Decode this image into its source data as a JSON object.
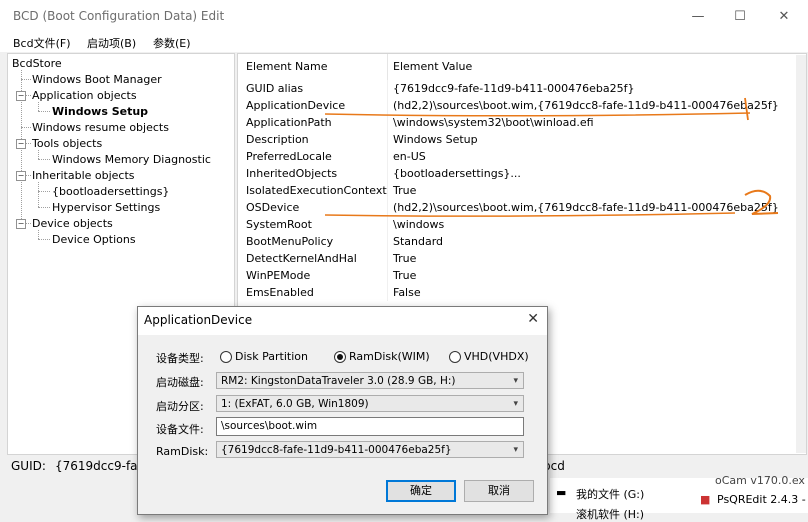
{
  "window": {
    "title": "BCD (Boot Configuration Data) Edit"
  },
  "menu": [
    "Bcd文件(F)",
    "启动项(B)",
    "参数(E)"
  ],
  "tree": {
    "root": "BcdStore",
    "nodes": [
      {
        "label": "Windows Boot Manager"
      },
      {
        "label": "Application objects",
        "children": [
          {
            "label": "Windows Setup",
            "selected": true
          }
        ]
      },
      {
        "label": "Windows resume objects"
      },
      {
        "label": "Tools objects",
        "children": [
          {
            "label": "Windows Memory Diagnostic"
          }
        ]
      },
      {
        "label": "Inheritable objects",
        "children": [
          {
            "label": "{bootloadersettings}"
          },
          {
            "label": "Hypervisor Settings"
          }
        ]
      },
      {
        "label": "Device objects",
        "children": [
          {
            "label": "Device Options"
          }
        ]
      }
    ]
  },
  "list": {
    "headers": [
      "Element Name",
      "Element Value"
    ],
    "rows": [
      [
        "GUID alias",
        "{7619dcc9-fafe-11d9-b411-000476eba25f}"
      ],
      [
        "ApplicationDevice",
        "(hd2,2)\\sources\\boot.wim,{7619dcc8-fafe-11d9-b411-000476eba25f}"
      ],
      [
        "ApplicationPath",
        "\\windows\\system32\\boot\\winload.efi"
      ],
      [
        "Description",
        "Windows Setup"
      ],
      [
        "PreferredLocale",
        "en-US"
      ],
      [
        "InheritedObjects",
        "{bootloadersettings}..."
      ],
      [
        "IsolatedExecutionContext",
        "True"
      ],
      [
        "OSDevice",
        "(hd2,2)\\sources\\boot.wim,{7619dcc8-fafe-11d9-b411-000476eba25f}"
      ],
      [
        "SystemRoot",
        "\\windows"
      ],
      [
        "BootMenuPolicy",
        "Standard"
      ],
      [
        "DetectKernelAndHal",
        "True"
      ],
      [
        "WinPEMode",
        "True"
      ],
      [
        "EmsEnabled",
        "False"
      ]
    ]
  },
  "status": {
    "guid_label": "GUID:",
    "guid_value": "{7619dcc9-fafe",
    "right_text": "bcd"
  },
  "desktop": {
    "items": [
      "oCam v170.0.ex",
      "我的文件 (G:)",
      "PsQREdit 2.4.3 -",
      "滚机软件 (H:)"
    ]
  },
  "annotations": {
    "mark1": "1",
    "mark2": "2",
    "color": "#e8791a"
  },
  "dialog": {
    "title": "ApplicationDevice",
    "device_type_label": "设备类型:",
    "radio_options": [
      "Disk Partition",
      "RamDisk(WIM)",
      "VHD(VHDX)"
    ],
    "selected_radio": "RamDisk(WIM)",
    "boot_disk_label": "启动磁盘:",
    "boot_disk_value": "RM2: KingstonDataTraveler 3.0 (28.9 GB, H:)",
    "boot_partition_label": "启动分区:",
    "boot_partition_value": "1: (ExFAT,  6.0 GB, Win1809)",
    "device_file_label": "设备文件:",
    "device_file_value": "\\sources\\boot.wim",
    "ramdisk_label": "RamDisk:",
    "ramdisk_value": "{7619dcc8-fafe-11d9-b411-000476eba25f}",
    "ok_label": "确定",
    "cancel_label": "取消"
  }
}
